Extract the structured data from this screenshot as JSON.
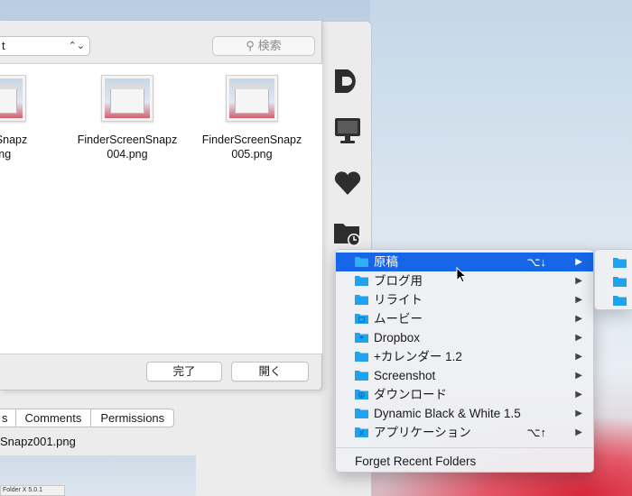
{
  "dialog": {
    "path_value": "t",
    "search_placeholder": "検索",
    "files": [
      {
        "name_line1": "reenSnapz",
        "name_line2": ".png"
      },
      {
        "name_line1": "FinderScreenSnapz",
        "name_line2": "004.png"
      },
      {
        "name_line1": "FinderScreenSnapz",
        "name_line2": "005.png"
      }
    ],
    "done_button": "完了",
    "open_button": "開く"
  },
  "info_panel": {
    "tabs": [
      "s",
      "Comments",
      "Permissions"
    ],
    "file_name": "Snapz001.png",
    "preview_caption": "Folder X 5.0.1"
  },
  "context_menu": {
    "items": [
      {
        "label": "原稿",
        "shortcut": "⌥↓",
        "selected": true,
        "icon": "folder-icon"
      },
      {
        "label": "ブログ用",
        "shortcut": "",
        "selected": false,
        "icon": "folder-icon"
      },
      {
        "label": "リライト",
        "shortcut": "",
        "selected": false,
        "icon": "folder-icon"
      },
      {
        "label": "ムービー",
        "shortcut": "",
        "selected": false,
        "icon": "movies-folder-icon"
      },
      {
        "label": "Dropbox",
        "shortcut": "",
        "selected": false,
        "icon": "dropbox-folder-icon"
      },
      {
        "label": "+カレンダー 1.2",
        "shortcut": "",
        "selected": false,
        "icon": "folder-icon"
      },
      {
        "label": "Screenshot",
        "shortcut": "",
        "selected": false,
        "icon": "folder-icon"
      },
      {
        "label": "ダウンロード",
        "shortcut": "",
        "selected": false,
        "icon": "downloads-folder-icon"
      },
      {
        "label": "Dynamic Black & White 1.5",
        "shortcut": "",
        "selected": false,
        "icon": "folder-icon"
      },
      {
        "label": "アプリケーション",
        "shortcut": "⌥↑",
        "selected": false,
        "icon": "applications-folder-icon"
      }
    ],
    "forget_label": "Forget Recent Folders"
  },
  "colors": {
    "selection": "#1766e8",
    "folder": "#1fa3ef"
  }
}
